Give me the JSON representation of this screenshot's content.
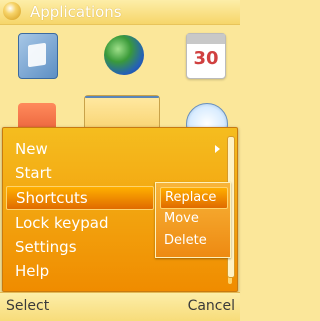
{
  "header": {
    "title": "Applications",
    "icon": "app-glyph-icon"
  },
  "grid": {
    "row1": [
      {
        "name": "folder-app-icon"
      },
      {
        "name": "globe-app-icon"
      },
      {
        "name": "calendar-app-icon",
        "label": "30"
      }
    ],
    "row2": [
      {
        "name": "music-app-icon"
      },
      {
        "name": "document-app-icon"
      },
      {
        "name": "clock-app-icon"
      }
    ]
  },
  "menu": {
    "items": [
      {
        "label": "New",
        "submenu": true
      },
      {
        "label": "Start"
      },
      {
        "label": "Shortcuts",
        "selected": true
      },
      {
        "label": "Lock keypad"
      },
      {
        "label": "Settings"
      },
      {
        "label": "Help"
      }
    ],
    "submenu": [
      {
        "label": "Replace",
        "selected": true
      },
      {
        "label": "Move"
      },
      {
        "label": "Delete"
      }
    ]
  },
  "softkeys": {
    "left": "Select",
    "right": "Cancel"
  },
  "colors": {
    "background": "#fbe79a",
    "menu_top": "#f5bd1f",
    "menu_bottom": "#f08c00",
    "highlight": "#e06a00",
    "text": "#ffffff"
  }
}
